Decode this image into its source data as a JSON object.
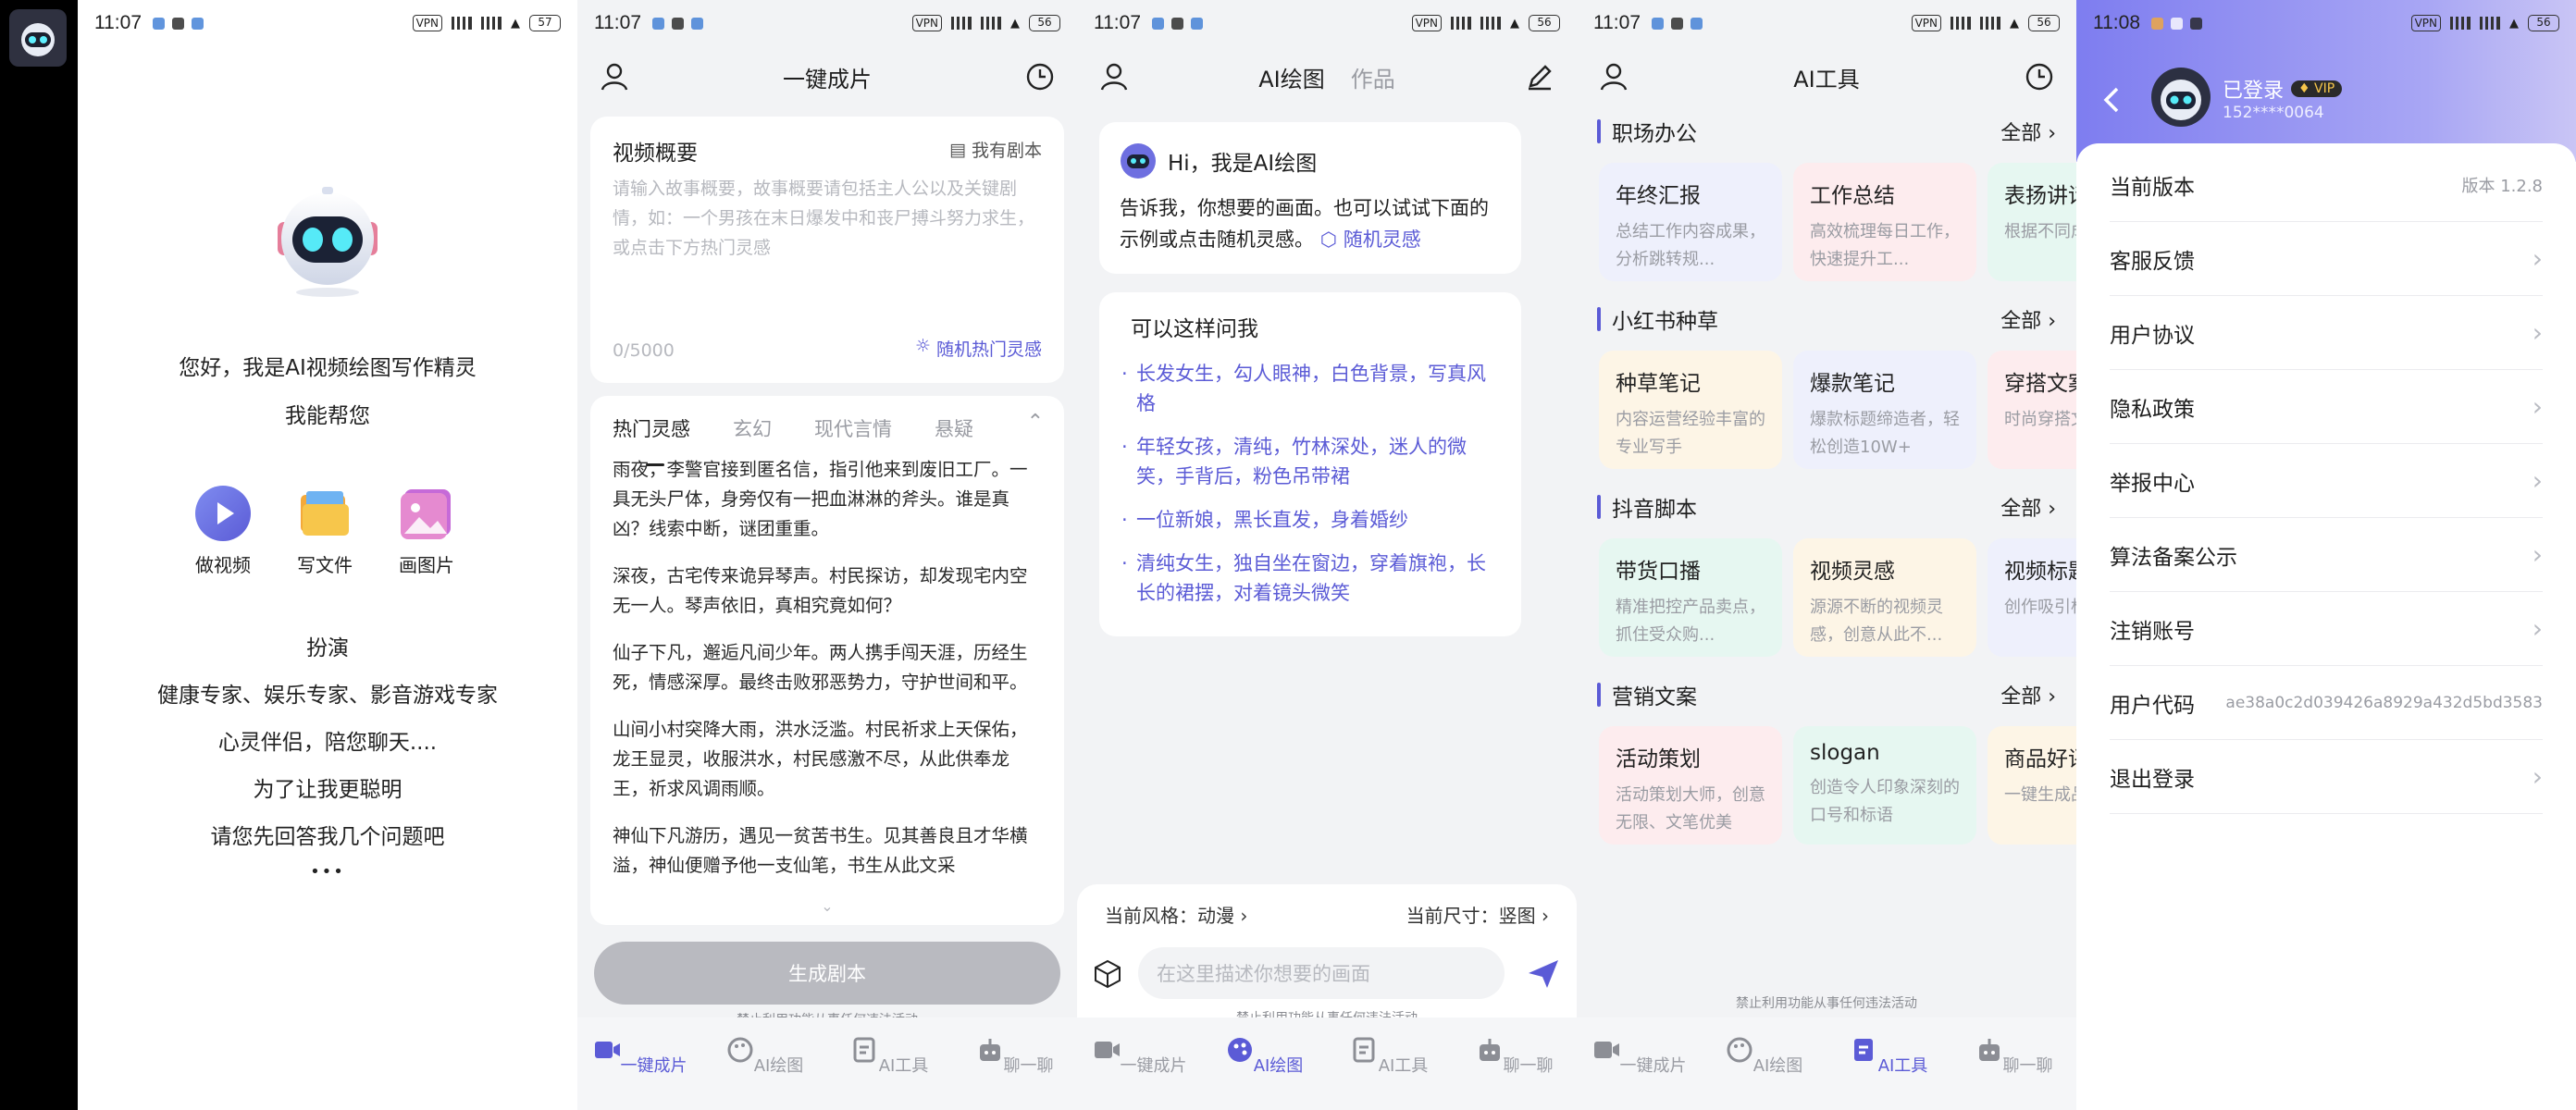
{
  "status": {
    "s1": {
      "time": "11:07",
      "battery": "57"
    },
    "s2": {
      "time": "11:07",
      "battery": "56"
    },
    "s3": {
      "time": "11:07",
      "battery": "56"
    },
    "s4": {
      "time": "11:07",
      "battery": "56"
    },
    "s5": {
      "time": "11:08",
      "battery": "56"
    },
    "vpn": "VPN"
  },
  "chat": {
    "greeting": "您好，我是AI视频绘图写作精灵",
    "help": "我能帮您",
    "features": [
      "做视频",
      "写文件",
      "画图片"
    ],
    "roles_title": "扮演",
    "roles": "健康专家、娱乐专家、影音游戏专家",
    "companion": "心灵伴侣，陪您聊天....",
    "smarter": "为了让我更聪明",
    "question": "请您先回答我几个问题吧",
    "typing": "•••"
  },
  "video": {
    "title": "一键成片",
    "summary_label": "视频概要",
    "script_btn": "我有剧本",
    "placeholder": "请输入故事概要，故事概要请包括主人公以及关键剧情，如：一个男孩在末日爆发中和丧尸搏斗努力求生，或点击下方热门灵感",
    "counter": "0/5000",
    "random_btn": "随机热门灵感",
    "tabs": [
      "热门灵感",
      "玄幻",
      "现代言情",
      "悬疑"
    ],
    "stories": [
      "雨夜，李警官接到匿名信，指引他来到废旧工厂。一具无头尸体，身旁仅有一把血淋淋的斧头。谁是真凶？线索中断，谜团重重。",
      "深夜，古宅传来诡异琴声。村民探访，却发现宅内空无一人。琴声依旧，真相究竟如何？",
      "仙子下凡，邂逅凡间少年。两人携手闯天涯，历经生死，情感深厚。最终击败邪恶势力，守护世间和平。",
      "山间小村突降大雨，洪水泛滥。村民祈求上天保佑，龙王显灵，收服洪水，村民感激不尽，从此供奉龙王，祈求风调雨顺。",
      "神仙下凡游历，遇见一贫苦书生。见其善良且才华横溢，神仙便赠予他一支仙笔，书生从此文采"
    ],
    "generate": "生成剧本",
    "notice": "禁止利用功能从事任何违法活动"
  },
  "draw": {
    "tab_active": "AI绘图",
    "tab_other": "作品",
    "hi": "Hi，我是AI绘图",
    "intro": "告诉我，你想要的画面。也可以试试下面的示例或点击随机灵感。",
    "random": "随机灵感",
    "ask_title": "可以这样问我",
    "examples": [
      "长发女生，勾人眼神，白色背景，写真风格",
      "年轻女孩，清纯，竹林深处，迷人的微笑，手背后，粉色吊带裙",
      "一位新娘，黑长直发，身着婚纱",
      "清纯女生，独自坐在窗边，穿着旗袍，长长的裙摆，对着镜头微笑"
    ],
    "style_label": "当前风格：动漫",
    "size_label": "当前尺寸：竖图",
    "input_placeholder": "在这里描述你想要的画面",
    "notice": "禁止利用功能从事任何违法活动"
  },
  "tools": {
    "title": "AI工具",
    "all": "全部",
    "sections": [
      {
        "name": "职场办公",
        "cards": [
          {
            "title": "年终汇报",
            "desc": "总结工作内容成果，分析跳转规..."
          },
          {
            "title": "工作总结",
            "desc": "高效梳理每日工作，快速提升工..."
          },
          {
            "title": "表扬讲话",
            "desc": "根据不同成真诚鼓"
          }
        ]
      },
      {
        "name": "小红书种草",
        "cards": [
          {
            "title": "种草笔记",
            "desc": "内容运营经验丰富的专业写手"
          },
          {
            "title": "爆款笔记",
            "desc": "爆款标题缔造者，轻松创造10W+"
          },
          {
            "title": "穿搭文案",
            "desc": "时尚穿搭文案"
          }
        ]
      },
      {
        "name": "抖音脚本",
        "cards": [
          {
            "title": "带货口播",
            "desc": "精准把控产品卖点，抓住受众购..."
          },
          {
            "title": "视频灵感",
            "desc": "源源不断的视频灵感，创意从此不..."
          },
          {
            "title": "视频标题",
            "desc": "创作吸引标题，优"
          }
        ]
      },
      {
        "name": "营销文案",
        "cards": [
          {
            "title": "活动策划",
            "desc": "活动策划大师，创意无限、文笔优美"
          },
          {
            "title": "slogan",
            "desc": "创造令人印象深刻的口号和标语"
          },
          {
            "title": "商品好评",
            "desc": "一键生成品好评"
          }
        ]
      }
    ],
    "notice": "禁止利用功能从事任何违法活动"
  },
  "tabs": [
    "一键成片",
    "AI绘图",
    "AI工具",
    "聊一聊"
  ],
  "profile": {
    "login": "已登录",
    "vip": "VIP",
    "phone": "152****0064",
    "rows": [
      {
        "label": "当前版本",
        "value": "版本 1.2.8"
      },
      {
        "label": "客服反馈"
      },
      {
        "label": "用户协议"
      },
      {
        "label": "隐私政策"
      },
      {
        "label": "举报中心"
      },
      {
        "label": "算法备案公示"
      },
      {
        "label": "注销账号"
      },
      {
        "label": "用户代码",
        "value": "ae38a0c2d039426a8929a432d5bd3583"
      },
      {
        "label": "退出登录"
      }
    ]
  },
  "colors": {
    "accent": "#5b5bd6",
    "card_blue": "#eef0fc",
    "card_pink": "#fdecee",
    "card_green": "#e6f7f1",
    "card_yellow": "#fdf5e6"
  }
}
